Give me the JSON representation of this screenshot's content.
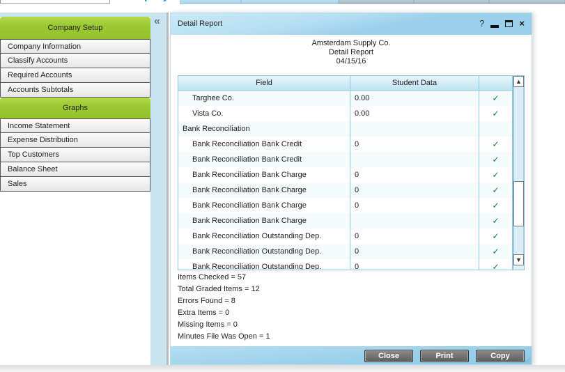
{
  "top_nav": {
    "active_tab": "Company"
  },
  "sidebar": {
    "collapse_icon": "«",
    "groups": [
      {
        "title": "Company Setup",
        "items": [
          "Company Information",
          "Classify Accounts",
          "Required Accounts",
          "Accounts Subtotals"
        ]
      },
      {
        "title": "Graphs",
        "items": [
          "Income Statement",
          "Expense Distribution",
          "Top Customers",
          "Balance Sheet",
          "Sales"
        ]
      }
    ]
  },
  "dialog": {
    "title": "Detail Report",
    "controls": {
      "help": "?",
      "close": "×"
    },
    "report_header": {
      "company": "Amsterdam Supply Co.",
      "report_name": "Detail Report",
      "date": "04/15/16"
    },
    "table": {
      "columns": [
        "Field",
        "Student Data",
        ""
      ],
      "rows": [
        {
          "field": "Targhee Co.",
          "indent": true,
          "value": "0.00",
          "check": "✓"
        },
        {
          "field": "Vista Co.",
          "indent": true,
          "value": "0.00",
          "check": "✓"
        },
        {
          "field": "Bank Reconciliation",
          "indent": false,
          "value": "",
          "check": ""
        },
        {
          "field": "Bank Reconciliation Bank Credit",
          "indent": true,
          "value": "0",
          "check": "✓"
        },
        {
          "field": "Bank Reconciliation Bank Credit",
          "indent": true,
          "value": "",
          "check": "✓"
        },
        {
          "field": "Bank Reconciliation Bank Charge",
          "indent": true,
          "value": "0",
          "check": "✓"
        },
        {
          "field": "Bank Reconciliation Bank Charge",
          "indent": true,
          "value": "0",
          "check": "✓"
        },
        {
          "field": "Bank Reconciliation Bank Charge",
          "indent": true,
          "value": "0",
          "check": "✓"
        },
        {
          "field": "Bank Reconciliation Bank Charge",
          "indent": true,
          "value": "",
          "check": "✓"
        },
        {
          "field": "Bank Reconciliation Outstanding Dep.",
          "indent": true,
          "value": "0",
          "check": "✓"
        },
        {
          "field": "Bank Reconciliation Outstanding Dep.",
          "indent": true,
          "value": "0",
          "check": "✓"
        },
        {
          "field": "Bank Reconciliation Outstanding Dep.",
          "indent": true,
          "value": "0",
          "check": "✓"
        }
      ],
      "scroll_up": "▲",
      "scroll_down": "▼"
    },
    "stats": [
      "Items Checked = 57",
      "Total Graded Items = 12",
      "Errors Found = 8",
      "Extra Items = 0",
      "Missing Items = 0",
      "Minutes File Was Open = 1"
    ],
    "buttons": {
      "close": "Close",
      "print": "Print",
      "copy": "Copy"
    }
  },
  "colors": {
    "group_header": "#9bc931",
    "accent_blue": "#1a8ccf",
    "titlebar": "#9ad0ea",
    "check": "#1a7a3a"
  }
}
